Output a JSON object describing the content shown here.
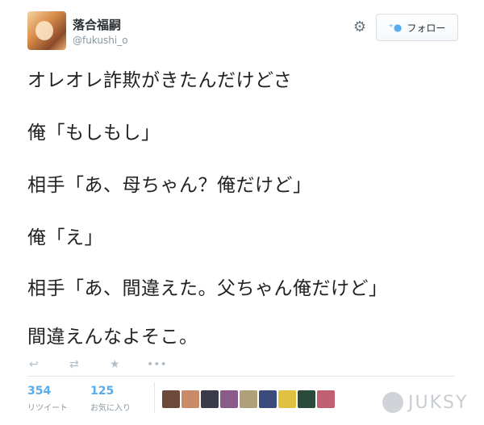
{
  "user": {
    "display_name": "落合福嗣",
    "screen_name": "@fukushi_o"
  },
  "header": {
    "gear_icon": "gear-icon",
    "follow_label": "フォロー",
    "follow_icon": "add-user-icon"
  },
  "tweet": {
    "lines": [
      "オレオレ詐欺がきたんだけどさ",
      "俺「もしもし」",
      "相手「あ、母ちゃん？俺だけど」",
      "俺「え」",
      "相手「あ、間違えた。父ちゃん俺だけど」",
      "間違えんなよそこ。"
    ]
  },
  "actions": {
    "reply_icon": "reply-icon",
    "retweet_icon": "retweet-icon",
    "favorite_icon": "star-icon",
    "more_icon": "more-icon"
  },
  "stats": {
    "retweets": {
      "count": "354",
      "label": "リツイート"
    },
    "favorites": {
      "count": "125",
      "label": "お気に入り"
    }
  },
  "faces": [
    "#6b4a3a",
    "#c98a6a",
    "#3a3a4a",
    "#8a5a8a",
    "#b0a07a",
    "#3a4a7a",
    "#e0c040",
    "#2a4a3a",
    "#c06070"
  ],
  "watermark": {
    "text": "JUKSY"
  }
}
